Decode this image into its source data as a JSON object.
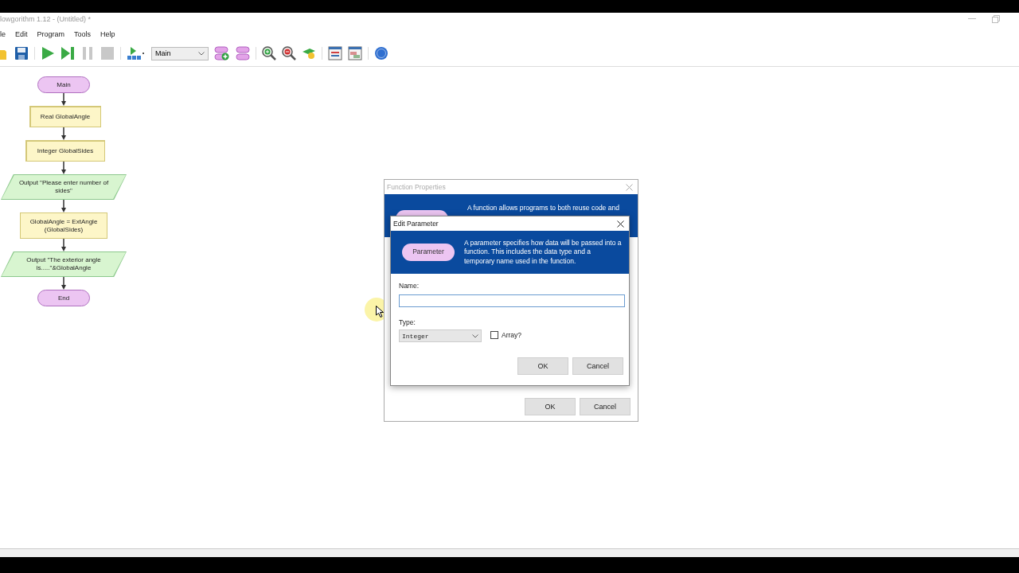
{
  "window": {
    "title": "lowgorithm 1.12 - (Untitled) *"
  },
  "menu": [
    "le",
    "Edit",
    "Program",
    "Tools",
    "Help"
  ],
  "toolbar": {
    "function_select": "Main"
  },
  "flowchart": [
    {
      "kind": "terminal",
      "text": "Main"
    },
    {
      "kind": "declare",
      "text": "Real GlobalAngle"
    },
    {
      "kind": "declare",
      "text": "Integer GlobalSides"
    },
    {
      "kind": "output",
      "text": "Output \"Please enter number of sides\""
    },
    {
      "kind": "process",
      "text": "GlobalAngle = ExtAngle (GlobalSides)"
    },
    {
      "kind": "output",
      "text": "Output \"The exterior angle is.....\"&GlobalAngle"
    },
    {
      "kind": "terminal",
      "text": "End"
    }
  ],
  "function_dialog": {
    "title": "Function Properties",
    "description": "A function allows programs to both reuse code and",
    "buttons": [
      "OK",
      "Cancel"
    ]
  },
  "parameter_dialog": {
    "title": "Edit Parameter",
    "pill": "Parameter",
    "description": "A parameter specifies how data will be passed into a function. This includes the data type and a temporary name used in the function.",
    "name_label": "Name:",
    "type_label": "Type:",
    "type_value": "Integer",
    "array": {
      "label": "Array?",
      "checked": false
    },
    "buttons": [
      "OK",
      "Cancel"
    ]
  }
}
